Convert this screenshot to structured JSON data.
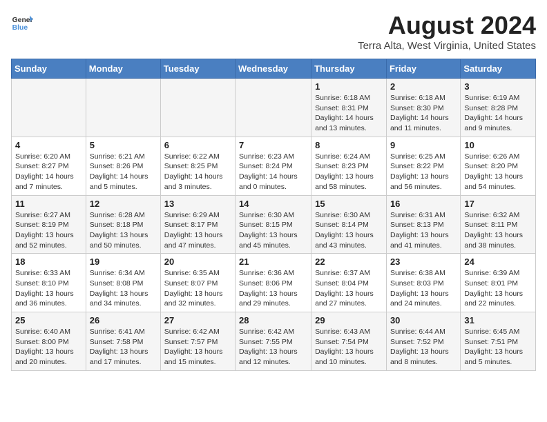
{
  "header": {
    "logo_line1": "General",
    "logo_line2": "Blue",
    "main_title": "August 2024",
    "subtitle": "Terra Alta, West Virginia, United States"
  },
  "days_of_week": [
    "Sunday",
    "Monday",
    "Tuesday",
    "Wednesday",
    "Thursday",
    "Friday",
    "Saturday"
  ],
  "weeks": [
    [
      {
        "day": "",
        "info": ""
      },
      {
        "day": "",
        "info": ""
      },
      {
        "day": "",
        "info": ""
      },
      {
        "day": "",
        "info": ""
      },
      {
        "day": "1",
        "info": "Sunrise: 6:18 AM\nSunset: 8:31 PM\nDaylight: 14 hours\nand 13 minutes."
      },
      {
        "day": "2",
        "info": "Sunrise: 6:18 AM\nSunset: 8:30 PM\nDaylight: 14 hours\nand 11 minutes."
      },
      {
        "day": "3",
        "info": "Sunrise: 6:19 AM\nSunset: 8:28 PM\nDaylight: 14 hours\nand 9 minutes."
      }
    ],
    [
      {
        "day": "4",
        "info": "Sunrise: 6:20 AM\nSunset: 8:27 PM\nDaylight: 14 hours\nand 7 minutes."
      },
      {
        "day": "5",
        "info": "Sunrise: 6:21 AM\nSunset: 8:26 PM\nDaylight: 14 hours\nand 5 minutes."
      },
      {
        "day": "6",
        "info": "Sunrise: 6:22 AM\nSunset: 8:25 PM\nDaylight: 14 hours\nand 3 minutes."
      },
      {
        "day": "7",
        "info": "Sunrise: 6:23 AM\nSunset: 8:24 PM\nDaylight: 14 hours\nand 0 minutes."
      },
      {
        "day": "8",
        "info": "Sunrise: 6:24 AM\nSunset: 8:23 PM\nDaylight: 13 hours\nand 58 minutes."
      },
      {
        "day": "9",
        "info": "Sunrise: 6:25 AM\nSunset: 8:22 PM\nDaylight: 13 hours\nand 56 minutes."
      },
      {
        "day": "10",
        "info": "Sunrise: 6:26 AM\nSunset: 8:20 PM\nDaylight: 13 hours\nand 54 minutes."
      }
    ],
    [
      {
        "day": "11",
        "info": "Sunrise: 6:27 AM\nSunset: 8:19 PM\nDaylight: 13 hours\nand 52 minutes."
      },
      {
        "day": "12",
        "info": "Sunrise: 6:28 AM\nSunset: 8:18 PM\nDaylight: 13 hours\nand 50 minutes."
      },
      {
        "day": "13",
        "info": "Sunrise: 6:29 AM\nSunset: 8:17 PM\nDaylight: 13 hours\nand 47 minutes."
      },
      {
        "day": "14",
        "info": "Sunrise: 6:30 AM\nSunset: 8:15 PM\nDaylight: 13 hours\nand 45 minutes."
      },
      {
        "day": "15",
        "info": "Sunrise: 6:30 AM\nSunset: 8:14 PM\nDaylight: 13 hours\nand 43 minutes."
      },
      {
        "day": "16",
        "info": "Sunrise: 6:31 AM\nSunset: 8:13 PM\nDaylight: 13 hours\nand 41 minutes."
      },
      {
        "day": "17",
        "info": "Sunrise: 6:32 AM\nSunset: 8:11 PM\nDaylight: 13 hours\nand 38 minutes."
      }
    ],
    [
      {
        "day": "18",
        "info": "Sunrise: 6:33 AM\nSunset: 8:10 PM\nDaylight: 13 hours\nand 36 minutes."
      },
      {
        "day": "19",
        "info": "Sunrise: 6:34 AM\nSunset: 8:08 PM\nDaylight: 13 hours\nand 34 minutes."
      },
      {
        "day": "20",
        "info": "Sunrise: 6:35 AM\nSunset: 8:07 PM\nDaylight: 13 hours\nand 32 minutes."
      },
      {
        "day": "21",
        "info": "Sunrise: 6:36 AM\nSunset: 8:06 PM\nDaylight: 13 hours\nand 29 minutes."
      },
      {
        "day": "22",
        "info": "Sunrise: 6:37 AM\nSunset: 8:04 PM\nDaylight: 13 hours\nand 27 minutes."
      },
      {
        "day": "23",
        "info": "Sunrise: 6:38 AM\nSunset: 8:03 PM\nDaylight: 13 hours\nand 24 minutes."
      },
      {
        "day": "24",
        "info": "Sunrise: 6:39 AM\nSunset: 8:01 PM\nDaylight: 13 hours\nand 22 minutes."
      }
    ],
    [
      {
        "day": "25",
        "info": "Sunrise: 6:40 AM\nSunset: 8:00 PM\nDaylight: 13 hours\nand 20 minutes."
      },
      {
        "day": "26",
        "info": "Sunrise: 6:41 AM\nSunset: 7:58 PM\nDaylight: 13 hours\nand 17 minutes."
      },
      {
        "day": "27",
        "info": "Sunrise: 6:42 AM\nSunset: 7:57 PM\nDaylight: 13 hours\nand 15 minutes."
      },
      {
        "day": "28",
        "info": "Sunrise: 6:42 AM\nSunset: 7:55 PM\nDaylight: 13 hours\nand 12 minutes."
      },
      {
        "day": "29",
        "info": "Sunrise: 6:43 AM\nSunset: 7:54 PM\nDaylight: 13 hours\nand 10 minutes."
      },
      {
        "day": "30",
        "info": "Sunrise: 6:44 AM\nSunset: 7:52 PM\nDaylight: 13 hours\nand 8 minutes."
      },
      {
        "day": "31",
        "info": "Sunrise: 6:45 AM\nSunset: 7:51 PM\nDaylight: 13 hours\nand 5 minutes."
      }
    ]
  ]
}
